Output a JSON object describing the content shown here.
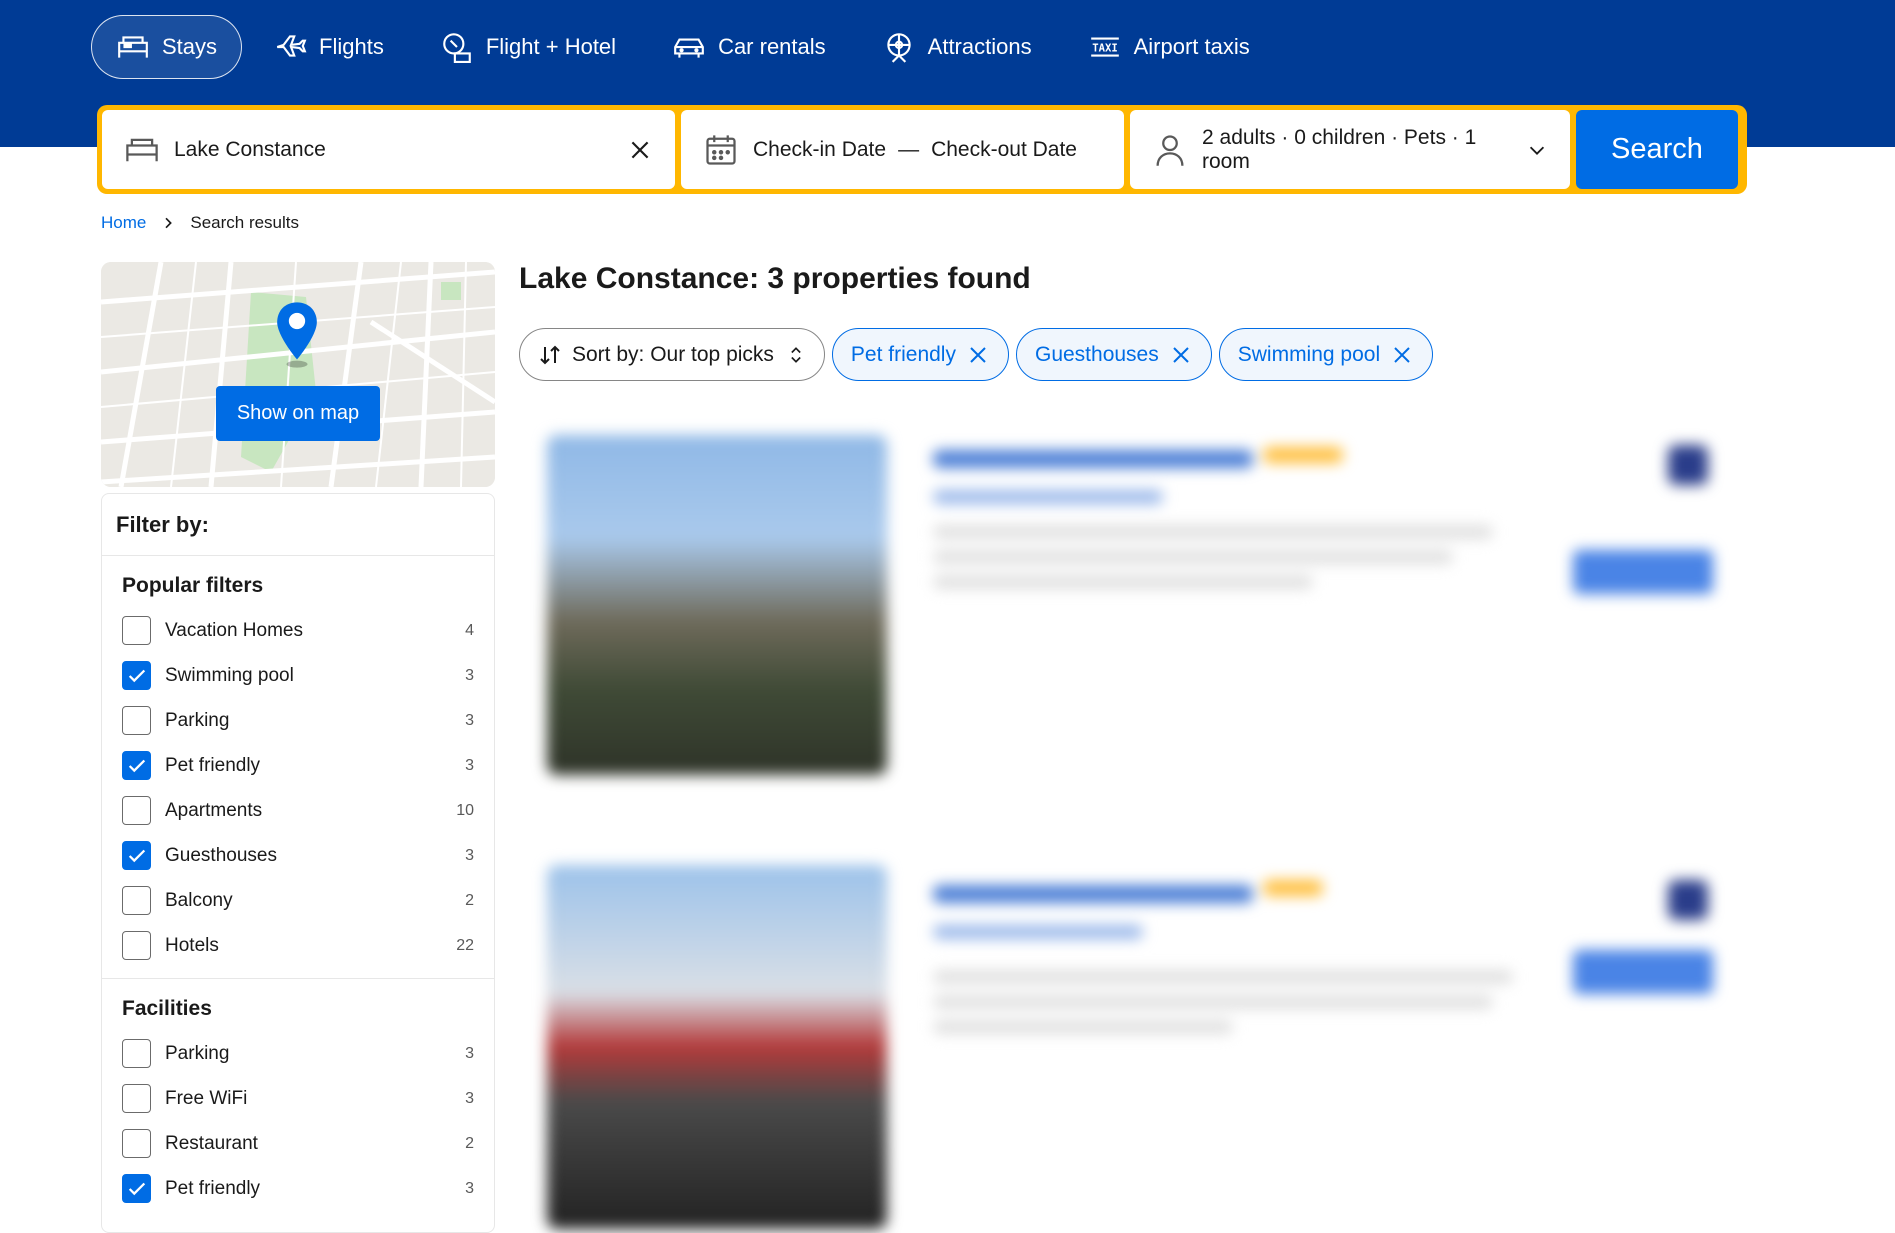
{
  "nav": {
    "items": [
      {
        "label": "Stays",
        "icon": "bed-icon",
        "active": true
      },
      {
        "label": "Flights",
        "icon": "plane-icon"
      },
      {
        "label": "Flight + Hotel",
        "icon": "flight-hotel-icon"
      },
      {
        "label": "Car rentals",
        "icon": "car-icon"
      },
      {
        "label": "Attractions",
        "icon": "ferris-wheel-icon"
      },
      {
        "label": "Airport taxis",
        "icon": "taxi-icon"
      }
    ]
  },
  "search": {
    "destination": "Lake Constance",
    "checkin_placeholder": "Check-in Date",
    "date_separator": "—",
    "checkout_placeholder": "Check-out Date",
    "occupancy": "2 adults · 0 children · Pets · 1 room",
    "button_label": "Search"
  },
  "breadcrumb": {
    "home": "Home",
    "current": "Search results"
  },
  "map": {
    "button_label": "Show on map"
  },
  "filters": {
    "title": "Filter by:",
    "popular": {
      "title": "Popular filters",
      "items": [
        {
          "label": "Vacation Homes",
          "count": "4",
          "checked": false
        },
        {
          "label": "Swimming pool",
          "count": "3",
          "checked": true
        },
        {
          "label": "Parking",
          "count": "3",
          "checked": false
        },
        {
          "label": "Pet friendly",
          "count": "3",
          "checked": true
        },
        {
          "label": "Apartments",
          "count": "10",
          "checked": false
        },
        {
          "label": "Guesthouses",
          "count": "3",
          "checked": true
        },
        {
          "label": "Balcony",
          "count": "2",
          "checked": false
        },
        {
          "label": "Hotels",
          "count": "22",
          "checked": false
        }
      ]
    },
    "facilities": {
      "title": "Facilities",
      "items": [
        {
          "label": "Parking",
          "count": "3",
          "checked": false
        },
        {
          "label": "Free WiFi",
          "count": "3",
          "checked": false
        },
        {
          "label": "Restaurant",
          "count": "2",
          "checked": false
        },
        {
          "label": "Pet friendly",
          "count": "3",
          "checked": true
        }
      ]
    }
  },
  "results": {
    "title": "Lake Constance: 3 properties found",
    "sort_label": "Sort by: Our top picks",
    "active_filters": [
      "Pet friendly",
      "Guesthouses",
      "Swimming pool"
    ]
  },
  "colors": {
    "brand_dark": "#003b95",
    "accent": "#006ce4",
    "search_border": "#ffb700"
  }
}
